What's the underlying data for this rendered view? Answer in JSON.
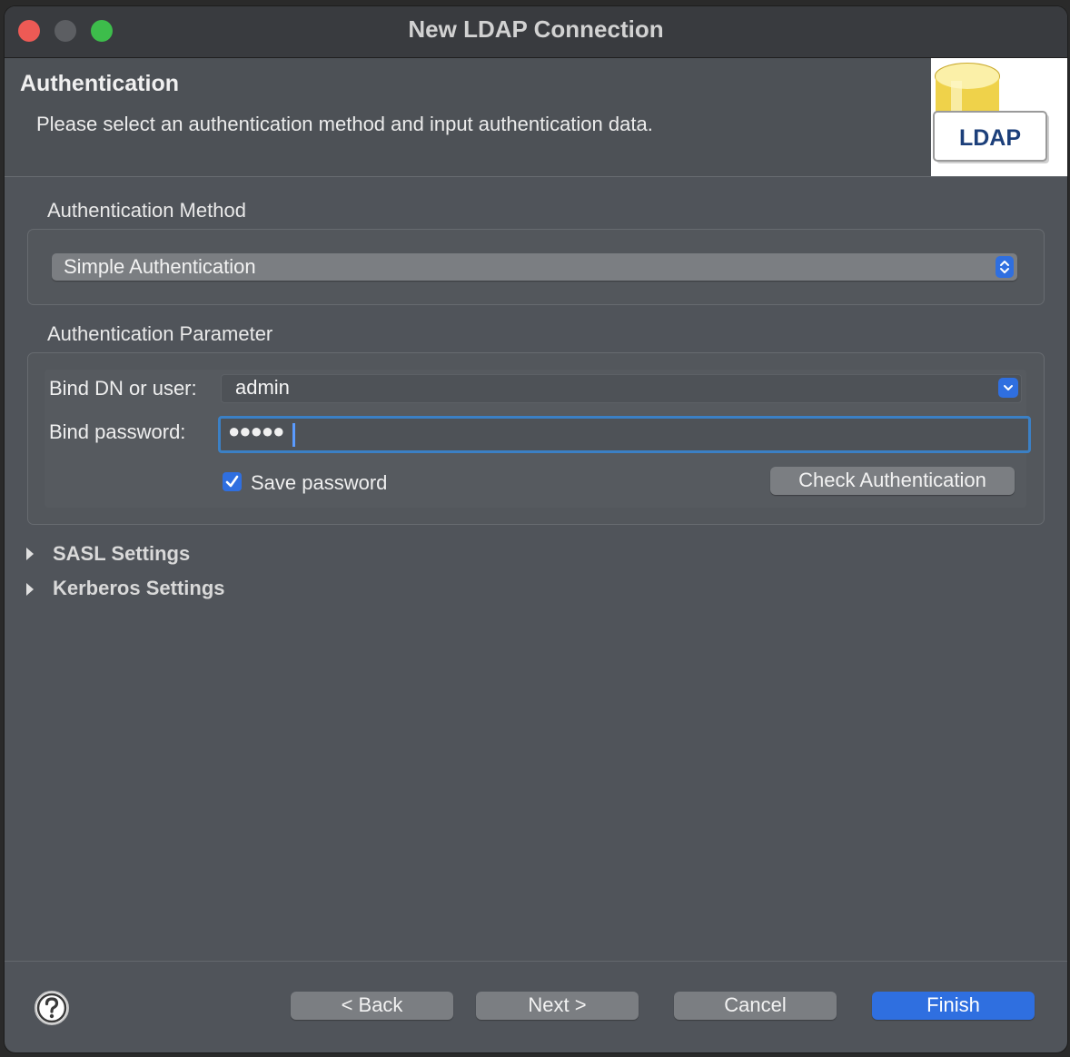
{
  "window": {
    "title": "New LDAP Connection"
  },
  "header": {
    "title": "Authentication",
    "description": "Please select an authentication method and input authentication data.",
    "logo_text": "LDAP"
  },
  "auth_method": {
    "section_label": "Authentication Method",
    "selected": "Simple Authentication"
  },
  "auth_params": {
    "section_label": "Authentication Parameter",
    "bind_dn_label": "Bind DN or user:",
    "bind_dn_value": "admin",
    "bind_password_label": "Bind password:",
    "bind_password_masked": "●●●●●",
    "save_password_label": "Save password",
    "save_password_checked": true,
    "check_button": "Check Authentication"
  },
  "expanders": [
    {
      "label": "SASL Settings",
      "expanded": false
    },
    {
      "label": "Kerberos Settings",
      "expanded": false
    }
  ],
  "footer": {
    "back": "< Back",
    "next": "Next >",
    "cancel": "Cancel",
    "finish": "Finish",
    "help_icon": "question-mark-icon"
  },
  "colors": {
    "accent": "#2f6fe0",
    "window_bg": "#50545a",
    "focus_ring": "#3b80c5"
  }
}
